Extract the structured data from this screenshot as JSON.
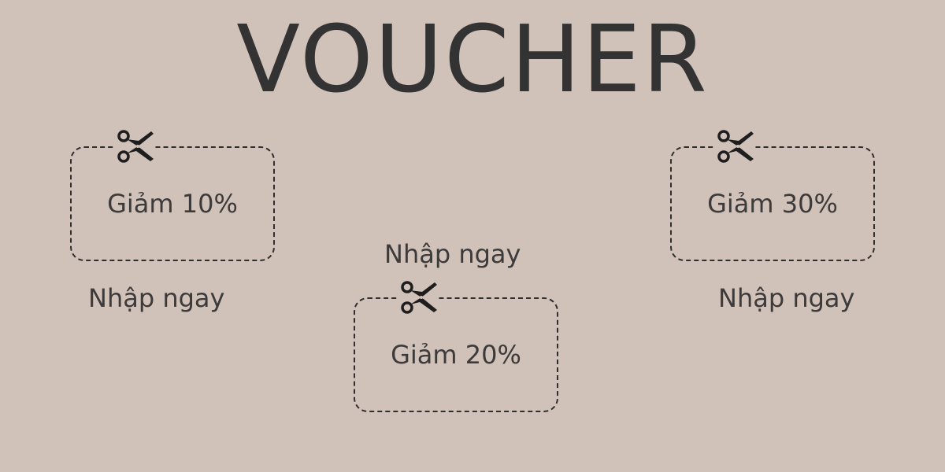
{
  "title": "VOUCHER",
  "colors": {
    "background": "#d0c2b8",
    "text": "#3a3838",
    "border": "#2e2e2e"
  },
  "vouchers": [
    {
      "label": "Giảm 10%",
      "cta": "Nhập ngay",
      "icon": "scissors-icon"
    },
    {
      "label": "Giảm 20%",
      "cta": "Nhập ngay",
      "icon": "scissors-icon"
    },
    {
      "label": "Giảm 30%",
      "cta": "Nhập ngay",
      "icon": "scissors-icon"
    }
  ]
}
